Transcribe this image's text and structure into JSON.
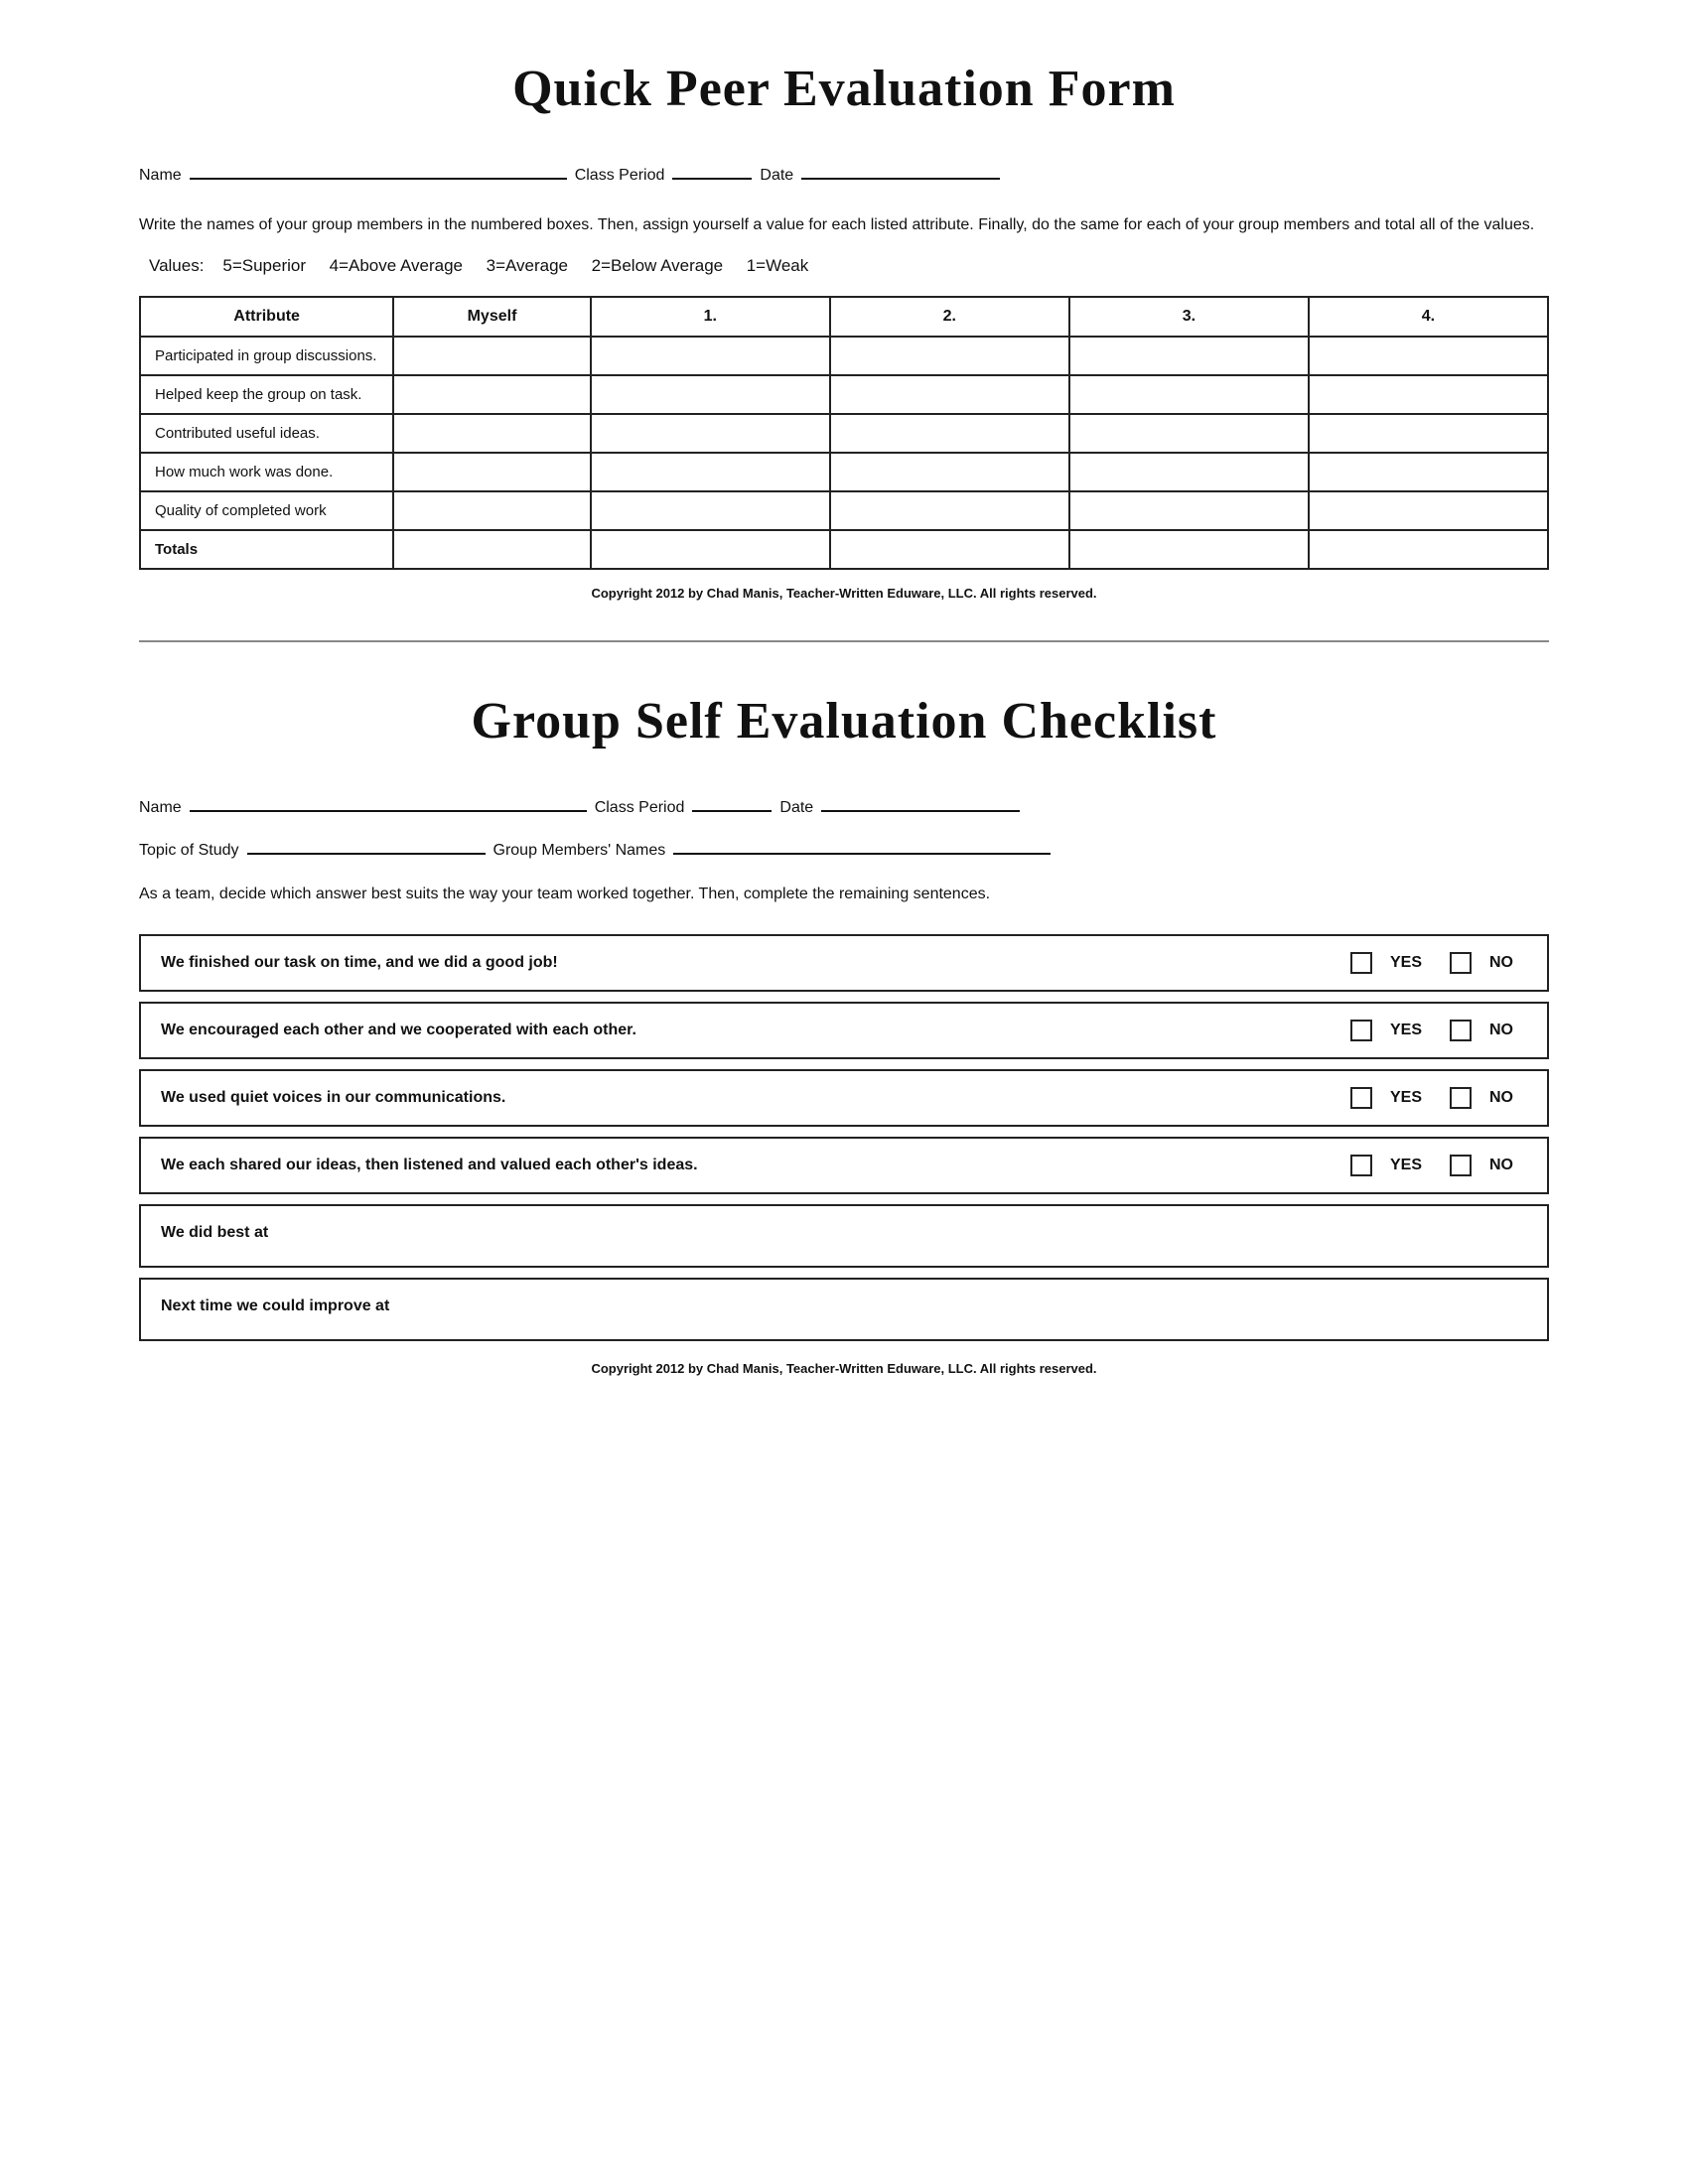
{
  "section1": {
    "title": "Quick Peer Evaluation Form",
    "name_label": "Name",
    "class_period_label": "Class Period",
    "date_label": "Date",
    "instructions": "Write the names of your group members in the numbered boxes.  Then,  assign yourself a value for each listed attribute.  Finally, do the same for each of your group members and total all of the values.",
    "values_label": "Values:",
    "values": "5=Superior    4=Above Average    3=Average    2=Below Average    1=Weak",
    "table": {
      "headers": [
        "Attribute",
        "Myself",
        "1.",
        "2.",
        "3.",
        "4."
      ],
      "rows": [
        [
          "Participated in group discussions.",
          "",
          "",
          "",
          "",
          ""
        ],
        [
          "Helped keep the group on task.",
          "",
          "",
          "",
          "",
          ""
        ],
        [
          "Contributed useful ideas.",
          "",
          "",
          "",
          "",
          ""
        ],
        [
          "How much work was done.",
          "",
          "",
          "",
          "",
          ""
        ],
        [
          "Quality of completed work",
          "",
          "",
          "",
          "",
          ""
        ],
        [
          "Totals",
          "",
          "",
          "",
          "",
          ""
        ]
      ],
      "totals_label": "Totals"
    },
    "copyright": "Copyright 2012 by Chad Manis, Teacher-Written Eduware, LLC.  All rights reserved."
  },
  "section2": {
    "title": "Group Self Evaluation Checklist",
    "name_label": "Name",
    "class_period_label": "Class Period",
    "date_label": "Date",
    "topic_label": "Topic of Study",
    "group_members_label": "Group Members' Names",
    "instructions": "As a team, decide which answer best suits the way your team worked together.  Then, complete the remaining sentences.",
    "checklist": [
      {
        "text": "We finished our task on time, and we did a good job!",
        "has_yn": true
      },
      {
        "text": "We encouraged each other and we cooperated with each other.",
        "has_yn": true
      },
      {
        "text": "We used quiet voices in our communications.",
        "has_yn": true
      },
      {
        "text": "We each shared our ideas, then listened and valued each other's ideas.",
        "has_yn": true
      },
      {
        "text": "We did best at",
        "has_yn": false
      },
      {
        "text": "Next time we could improve at",
        "has_yn": false
      }
    ],
    "yes_label": "YES",
    "no_label": "NO",
    "copyright": "Copyright 2012 by Chad Manis, Teacher-Written Eduware, LLC.  All rights reserved."
  }
}
